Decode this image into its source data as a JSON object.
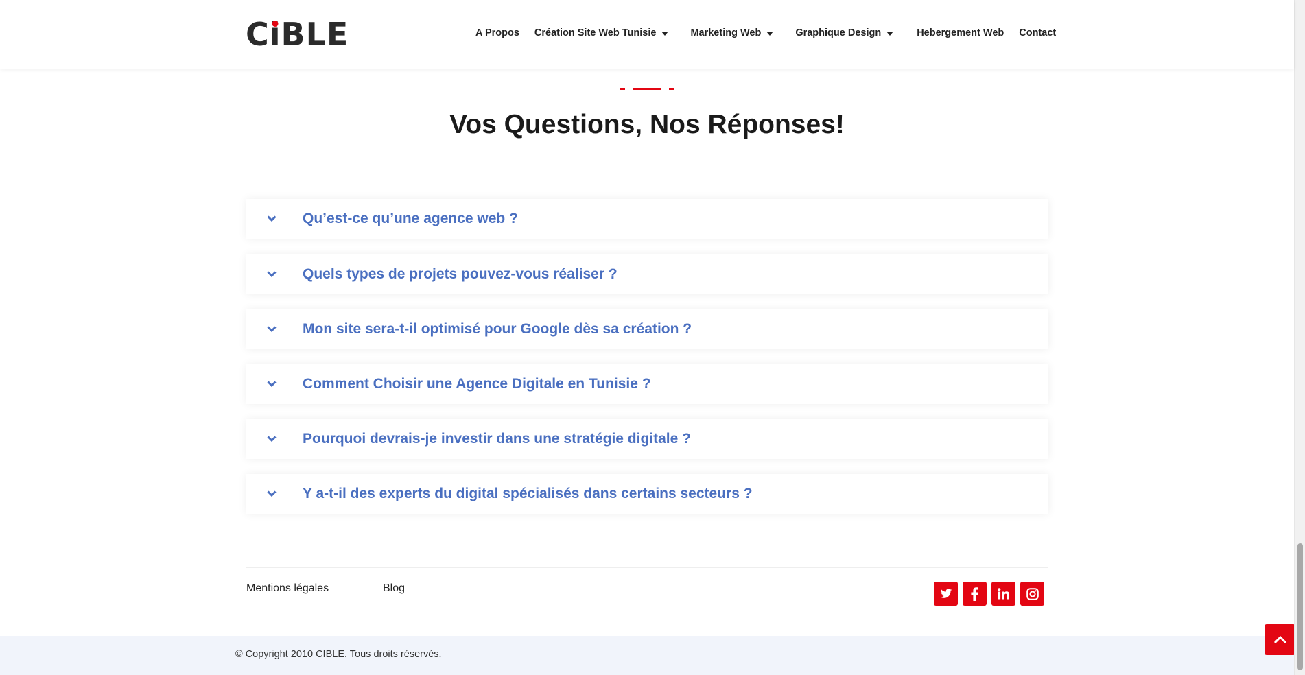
{
  "header": {
    "logo_text_pre": "C",
    "logo_text_i": "i",
    "logo_text_post": "BLE",
    "nav": [
      {
        "label": "A Propos",
        "has_dropdown": false
      },
      {
        "label": "Création Site Web Tunisie",
        "has_dropdown": true
      },
      {
        "label": "Marketing Web",
        "has_dropdown": true
      },
      {
        "label": "Graphique Design",
        "has_dropdown": true
      },
      {
        "label": "Hebergement Web",
        "has_dropdown": false
      },
      {
        "label": "Contact",
        "has_dropdown": false
      }
    ]
  },
  "faq": {
    "title": "Vos Questions, Nos Réponses!",
    "items": [
      {
        "question": "Qu’est-ce qu’une agence web ?"
      },
      {
        "question": "Quels types de projets pouvez-vous réaliser ?"
      },
      {
        "question": "Mon site sera-t-il optimisé pour Google dès sa création ?"
      },
      {
        "question": "Comment Choisir une Agence Digitale en Tunisie ?"
      },
      {
        "question": "Pourquoi devrais-je investir dans une stratégie digitale ?"
      },
      {
        "question": "Y a-t-il des experts du digital spécialisés dans certains secteurs ?"
      }
    ]
  },
  "footer": {
    "links": [
      {
        "label": "Mentions légales"
      },
      {
        "label": "Blog"
      }
    ],
    "social": [
      {
        "icon": "twitter-icon"
      },
      {
        "icon": "facebook-icon"
      },
      {
        "icon": "linkedin-icon"
      },
      {
        "icon": "instagram-icon"
      }
    ],
    "copyright": "© Copyright 2010 CIBLE. Tous droits réservés."
  },
  "colors": {
    "accent": "#e30613",
    "question": "#4a6fc0",
    "bottom_bar": "#f1f4fb"
  }
}
